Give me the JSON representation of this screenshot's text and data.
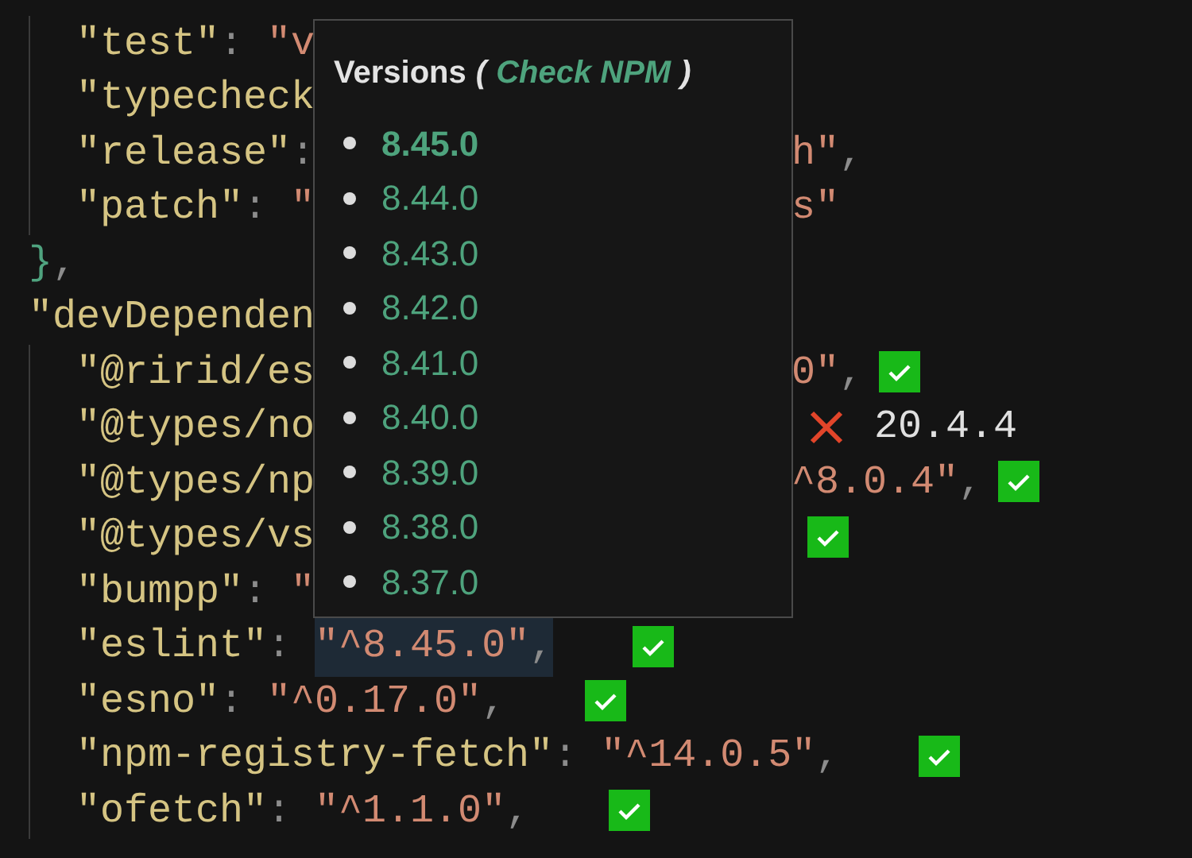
{
  "code": [
    {
      "children": [
        {
          "tokens": [
            {
              "kind": "key",
              "text": "\"test\""
            },
            {
              "kind": "punct",
              "text": ": "
            },
            {
              "kind": "string",
              "text": "\"v"
            }
          ]
        },
        {
          "tokens": [
            {
              "kind": "key",
              "text": "\"typecheck"
            }
          ]
        },
        {
          "tokens": [
            {
              "kind": "key",
              "text": "\"release\""
            },
            {
              "kind": "punct",
              "text": ":"
            }
          ],
          "after": [
            {
              "kind": "string",
              "text": "h\""
            },
            {
              "kind": "punct",
              "text": ","
            }
          ]
        },
        {
          "tokens": [
            {
              "kind": "key",
              "text": "\"patch\""
            },
            {
              "kind": "punct",
              "text": ": "
            },
            {
              "kind": "string",
              "text": "\""
            }
          ],
          "after": [
            {
              "kind": "string",
              "text": "s\""
            }
          ]
        }
      ]
    },
    {
      "tokens": [
        {
          "kind": "brace",
          "text": "}"
        },
        {
          "kind": "punct",
          "text": ","
        }
      ]
    },
    {
      "tokens": [
        {
          "kind": "key",
          "text": "\"devDependen"
        }
      ],
      "children": [
        {
          "tokens": [
            {
              "kind": "key",
              "text": "\"@ririd/es"
            }
          ],
          "after": [
            {
              "kind": "string",
              "text": "0\""
            },
            {
              "kind": "punct",
              "text": ","
            }
          ],
          "badge": {
            "kind": "check"
          }
        },
        {
          "tokens": [
            {
              "kind": "key",
              "text": "\"@types/no"
            }
          ],
          "badge": {
            "kind": "cross",
            "hint": "20.4.4"
          }
        },
        {
          "tokens": [
            {
              "kind": "key",
              "text": "\"@types/np"
            }
          ],
          "after": [
            {
              "kind": "string",
              "text": "^8.0.4\""
            },
            {
              "kind": "punct",
              "text": ","
            }
          ],
          "badge": {
            "kind": "check"
          }
        },
        {
          "tokens": [
            {
              "kind": "key",
              "text": "\"@types/vs"
            }
          ],
          "badge": {
            "kind": "check"
          }
        },
        {
          "tokens": [
            {
              "kind": "key",
              "text": "\"bumpp\""
            },
            {
              "kind": "punct",
              "text": ": "
            },
            {
              "kind": "string",
              "text": "\""
            }
          ]
        },
        {
          "tokens": [
            {
              "kind": "key",
              "text": "\"eslint\""
            },
            {
              "kind": "punct",
              "text": ": "
            },
            {
              "kind": "string",
              "text": "\"^8.45.0\"",
              "highlighted": true
            },
            {
              "kind": "punct",
              "text": ",",
              "highlighted": true
            }
          ],
          "badge": {
            "kind": "check"
          }
        },
        {
          "tokens": [
            {
              "kind": "key",
              "text": "\"esno\""
            },
            {
              "kind": "punct",
              "text": ": "
            },
            {
              "kind": "string",
              "text": "\"^0.17.0\""
            },
            {
              "kind": "punct",
              "text": ","
            }
          ],
          "badge": {
            "kind": "check"
          }
        },
        {
          "tokens": [
            {
              "kind": "key",
              "text": "\"npm-registry-fetch\""
            },
            {
              "kind": "punct",
              "text": ": "
            },
            {
              "kind": "string",
              "text": "\"^14.0.5\""
            },
            {
              "kind": "punct",
              "text": ","
            }
          ],
          "badge": {
            "kind": "check"
          }
        },
        {
          "tokens": [
            {
              "kind": "key",
              "text": "\"ofetch\""
            },
            {
              "kind": "punct",
              "text": ": "
            },
            {
              "kind": "string",
              "text": "\"^1.1.0\""
            },
            {
              "kind": "punct",
              "text": ","
            }
          ],
          "badge": {
            "kind": "check"
          }
        }
      ]
    }
  ],
  "popup": {
    "title": "Versions",
    "open_paren": "(",
    "link": "Check NPM",
    "close_paren": ")",
    "versions": [
      {
        "text": "8.45.0",
        "current": true
      },
      {
        "text": "8.44.0",
        "current": false
      },
      {
        "text": "8.43.0",
        "current": false
      },
      {
        "text": "8.42.0",
        "current": false
      },
      {
        "text": "8.41.0",
        "current": false
      },
      {
        "text": "8.40.0",
        "current": false
      },
      {
        "text": "8.39.0",
        "current": false
      },
      {
        "text": "8.38.0",
        "current": false
      },
      {
        "text": "8.37.0",
        "current": false
      }
    ]
  }
}
